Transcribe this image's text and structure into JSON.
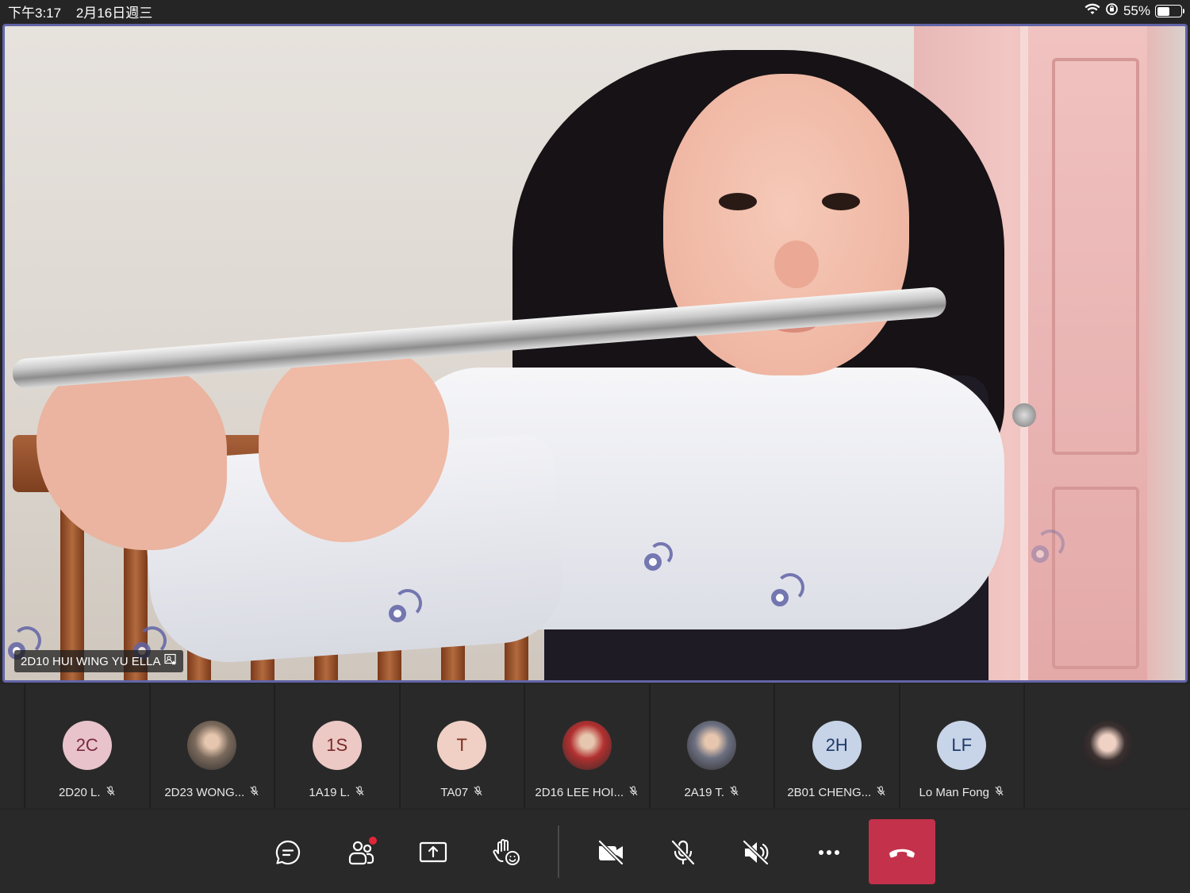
{
  "status_bar": {
    "time": "下午3:17",
    "date": "2月16日週三",
    "battery": "55%",
    "battery_level": 0.55
  },
  "main_video": {
    "participant_name": "2D10 HUI WING YU ELLA"
  },
  "participants": [
    {
      "initials": "2C",
      "name": "2D20 L.",
      "avatar_color": "#e8c3cc",
      "text_color": "#7a2a40",
      "photo": false
    },
    {
      "initials": "",
      "name": "2D23 WONG...",
      "avatar_color": "#7a6a5c",
      "text_color": "#ffffff",
      "photo": true
    },
    {
      "initials": "1S",
      "name": "1A19 L.",
      "avatar_color": "#ecc9c5",
      "text_color": "#7a2a2a",
      "photo": false
    },
    {
      "initials": "T",
      "name": "TA07",
      "avatar_color": "#f0cfc4",
      "text_color": "#7a3020",
      "photo": false
    },
    {
      "initials": "",
      "name": "2D16 LEE HOI...",
      "avatar_color": "#b23030",
      "text_color": "#ffffff",
      "photo": true
    },
    {
      "initials": "",
      "name": "2A19 T.",
      "avatar_color": "#6b6f80",
      "text_color": "#ffffff",
      "photo": true
    },
    {
      "initials": "2H",
      "name": "2B01 CHENG...",
      "avatar_color": "#c7d3e6",
      "text_color": "#1f3a6a",
      "photo": false
    },
    {
      "initials": "LF",
      "name": "Lo Man Fong",
      "avatar_color": "#c8d4e8",
      "text_color": "#1f3a6a",
      "photo": false
    }
  ],
  "self_view": {
    "photo": true,
    "avatar_color": "#3a3030"
  },
  "controls": {
    "chat": "chat-icon",
    "participants": "people-icon",
    "share": "share-screen-icon",
    "reactions": "raise-hand-icon",
    "camera": "camera-off-icon",
    "mic": "mic-off-icon",
    "speaker": "speaker-off-icon",
    "more": "more-icon",
    "hangup": "hang-up-icon"
  },
  "colors": {
    "accent": "#6264a7",
    "hangup": "#c4314b",
    "notification": "#e0263a"
  }
}
